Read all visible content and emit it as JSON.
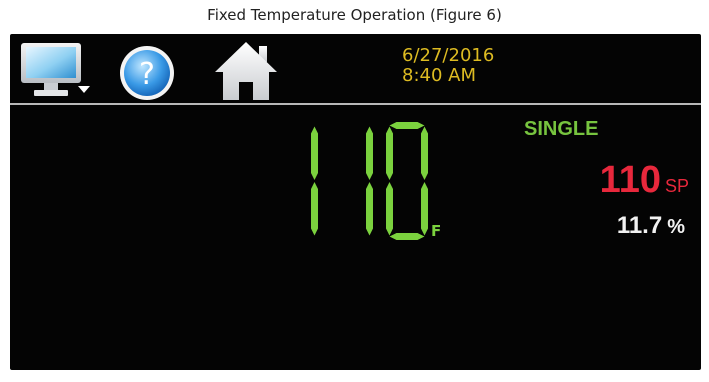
{
  "caption": "Fixed Temperature Operation (Figure 6)",
  "toolbar": {
    "icons": [
      "monitor-icon",
      "help-icon",
      "home-icon"
    ],
    "date": "6/27/2016",
    "time": "8:40 AM"
  },
  "display": {
    "temperature": "110",
    "units": "F",
    "mode": "SINGLE",
    "setpoint": "110",
    "setpoint_label": "SP",
    "output": "11.7",
    "output_unit": "%"
  },
  "colors": {
    "segment_green": "#7bd23e",
    "mode_green": "#77c43f",
    "setpoint_red": "#e8283c",
    "datetime_yellow": "#ddbb22",
    "background": "#040404"
  }
}
